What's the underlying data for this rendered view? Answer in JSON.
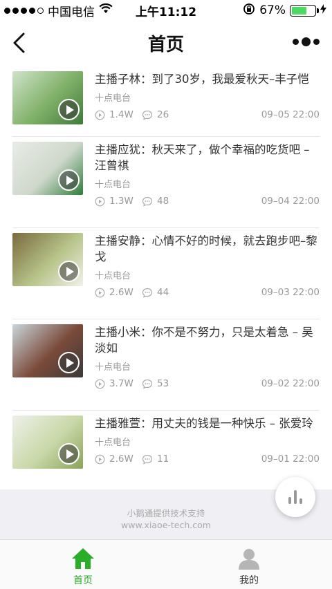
{
  "status_bar": {
    "carrier": "中国电信",
    "time": "上午11:12",
    "battery": "67%",
    "battery_level": 0.67,
    "battery_color": "#4cd964"
  },
  "navbar": {
    "title": "首页",
    "back_icon": "chevron-left-icon",
    "more_icon": "more-dots-icon"
  },
  "articles": [
    {
      "title": "主播子林：到了30岁，我最爱秋天–丰子恺",
      "source": "十点电台",
      "views": "1.4W",
      "comments": "26",
      "date": "09–05 22:00",
      "thumb_colors": [
        "#cfe3c8",
        "#7fb068",
        "#3f7a3a"
      ]
    },
    {
      "title": "主播应犹：秋天来了，做个幸福的吃货吧 –汪曾祺",
      "source": "十点电台",
      "views": "1.3W",
      "comments": "48",
      "date": "09–04 22:00",
      "thumb_colors": [
        "#e8ece6",
        "#cfd8cc",
        "#2f7d3a"
      ]
    },
    {
      "title": "主播安静：心情不好的时候，就去跑步吧–黎戈",
      "source": "十点电台",
      "views": "2.6W",
      "comments": "44",
      "date": "09–03 22:00",
      "thumb_colors": [
        "#7a6a3c",
        "#b7c48a",
        "#f2f0ea"
      ]
    },
    {
      "title": "主播小米：你不是不努力，只是太着急 – 吴淡如",
      "source": "十点电台",
      "views": "3.7W",
      "comments": "53",
      "date": "09–02 22:00",
      "thumb_colors": [
        "#c9d6dc",
        "#7b4a3a",
        "#3a3a3a"
      ]
    },
    {
      "title": "主播雅萱：用丈夫的钱是一种快乐 – 张爱玲",
      "source": "十点电台",
      "views": "2.6W",
      "comments": "11",
      "date": "09–01 22:00",
      "thumb_colors": [
        "#eef0ea",
        "#c9d8a8",
        "#8aa35a"
      ]
    }
  ],
  "footer": {
    "line1": "小鹅通提供技术支持",
    "line2": "www.xiaoe-tech.com"
  },
  "tabbar": {
    "home_label": "首页",
    "mine_label": "我的",
    "active_color": "#2aae2a"
  }
}
